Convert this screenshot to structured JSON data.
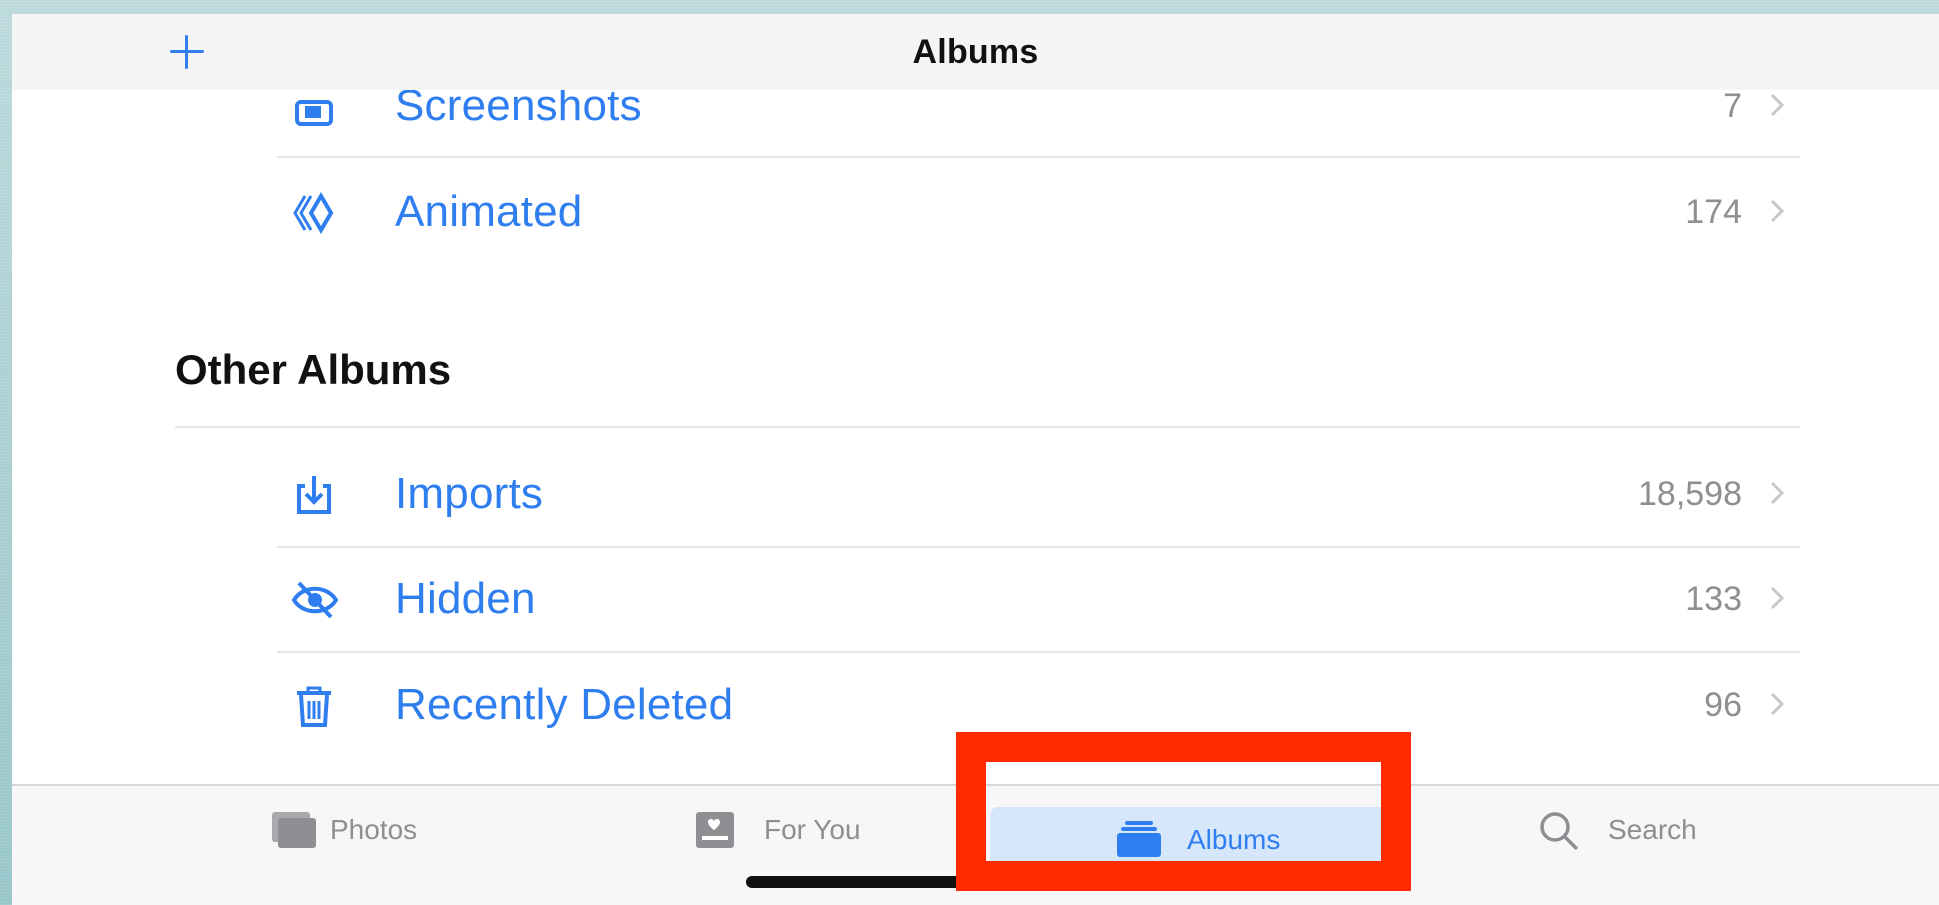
{
  "navbar": {
    "title": "Albums",
    "add_icon": "plus-icon"
  },
  "sections": {
    "media_types": {
      "items": [
        {
          "label": "Screenshots",
          "count": "7",
          "icon": "screenshot-icon"
        },
        {
          "label": "Animated",
          "count": "174",
          "icon": "animated-icon"
        }
      ]
    },
    "other_albums": {
      "title": "Other Albums",
      "items": [
        {
          "label": "Imports",
          "count": "18,598",
          "icon": "import-icon"
        },
        {
          "label": "Hidden",
          "count": "133",
          "icon": "hidden-eye-icon"
        },
        {
          "label": "Recently Deleted",
          "count": "96",
          "icon": "trash-icon"
        }
      ]
    }
  },
  "tabbar": {
    "tabs": [
      {
        "label": "Photos",
        "icon": "photos-icon",
        "selected": false
      },
      {
        "label": "For You",
        "icon": "for-you-icon",
        "selected": false
      },
      {
        "label": "Albums",
        "icon": "albums-icon",
        "selected": true
      },
      {
        "label": "Search",
        "icon": "search-icon",
        "selected": false
      }
    ]
  },
  "colors": {
    "accent": "#2f7ef0",
    "secondary_text": "#8e8e93",
    "highlight": "#ff2a00",
    "selected_tab_bg": "#d6e6fb"
  }
}
